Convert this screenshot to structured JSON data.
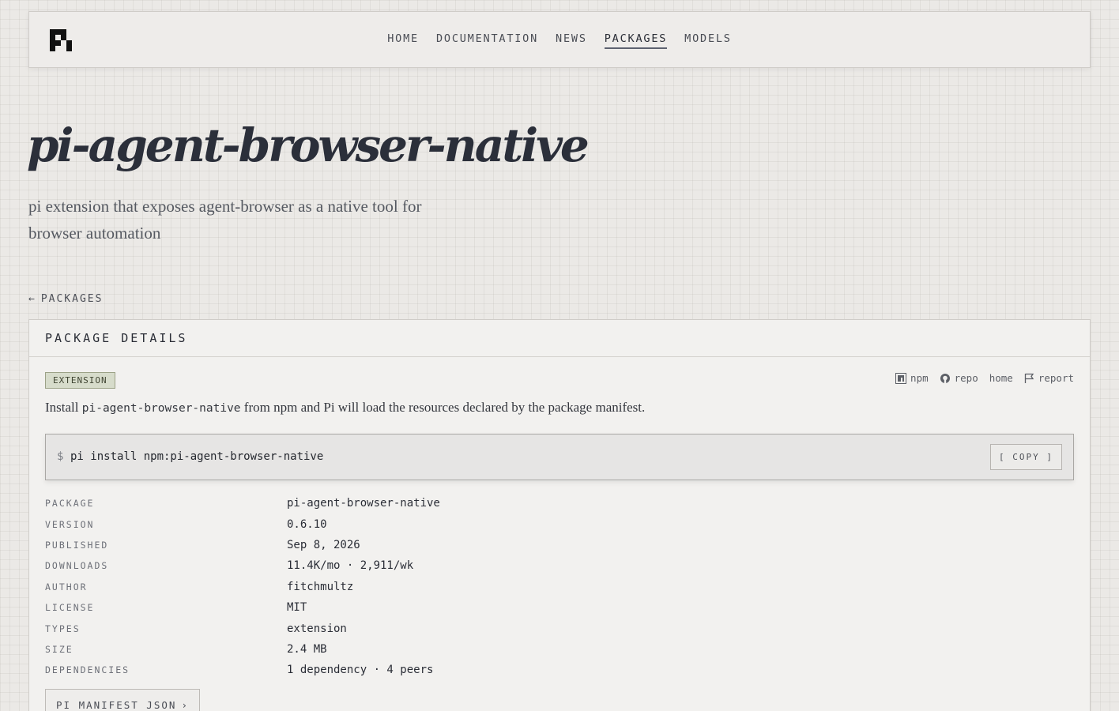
{
  "nav": {
    "items": [
      {
        "label": "HOME"
      },
      {
        "label": "DOCUMENTATION"
      },
      {
        "label": "NEWS"
      },
      {
        "label": "PACKAGES"
      },
      {
        "label": "MODELS"
      }
    ],
    "active": "PACKAGES"
  },
  "hero": {
    "title": "pi-agent-browser-native",
    "subtitle": "pi extension that exposes agent-browser as a native tool for browser automation"
  },
  "back_link": {
    "arrow": "←",
    "label": "PACKAGES"
  },
  "card": {
    "header": "PACKAGE DETAILS",
    "badge": "EXTENSION",
    "links": [
      {
        "label": "npm",
        "icon": "npm-icon"
      },
      {
        "label": "repo",
        "icon": "github-icon"
      },
      {
        "label": "home",
        "icon": ""
      },
      {
        "label": "report",
        "icon": "flag-icon"
      }
    ],
    "install": {
      "prefix": "Install ",
      "package": "pi-agent-browser-native",
      "suffix": " from npm and Pi will load the resources declared by the package manifest."
    },
    "command": {
      "prompt": "$",
      "text": "pi install npm:pi-agent-browser-native",
      "copy_label": "[ COPY ]"
    },
    "details": [
      {
        "key": "PACKAGE",
        "value": "pi-agent-browser-native"
      },
      {
        "key": "VERSION",
        "value": "0.6.10"
      },
      {
        "key": "PUBLISHED",
        "value": "Sep 8, 2026"
      },
      {
        "key": "DOWNLOADS",
        "value": "11.4K/mo · 2,911/wk"
      },
      {
        "key": "AUTHOR",
        "value": "fitchmultz"
      },
      {
        "key": "LICENSE",
        "value": "MIT"
      },
      {
        "key": "TYPES",
        "value": "extension"
      },
      {
        "key": "SIZE",
        "value": "2.4 MB"
      },
      {
        "key": "DEPENDENCIES",
        "value": "1 dependency · 4 peers"
      }
    ],
    "manifest_button": "PI MANIFEST JSON",
    "manifest_chevron": "›"
  },
  "colors": {
    "background": "#ebe9e6",
    "text": "#2a2d36",
    "badge_bg": "#d7dccb"
  }
}
